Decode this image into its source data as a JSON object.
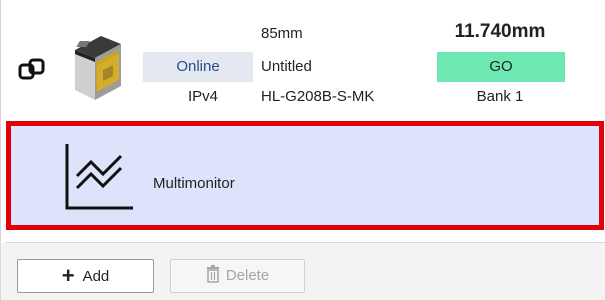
{
  "device": {
    "status": "Online",
    "ip_type": "IPv4",
    "range": "85mm",
    "name": "Untitled",
    "model": "HL-G208B-S-MK",
    "measurement": "11.740mm",
    "judgement": "GO",
    "bank": "Bank 1",
    "icons": {
      "link": "link-icon",
      "sensor": "sensor-image"
    },
    "colors": {
      "status_bg": "#e4e8f0",
      "judgement_bg": "#6ee8b2"
    }
  },
  "multimonitor": {
    "label": "Multimonitor",
    "icon": "chart-line-icon",
    "colors": {
      "selected_bg": "#dde3fb",
      "selection_border": "#e0000b"
    }
  },
  "footer": {
    "add_label": "Add",
    "delete_label": "Delete"
  }
}
